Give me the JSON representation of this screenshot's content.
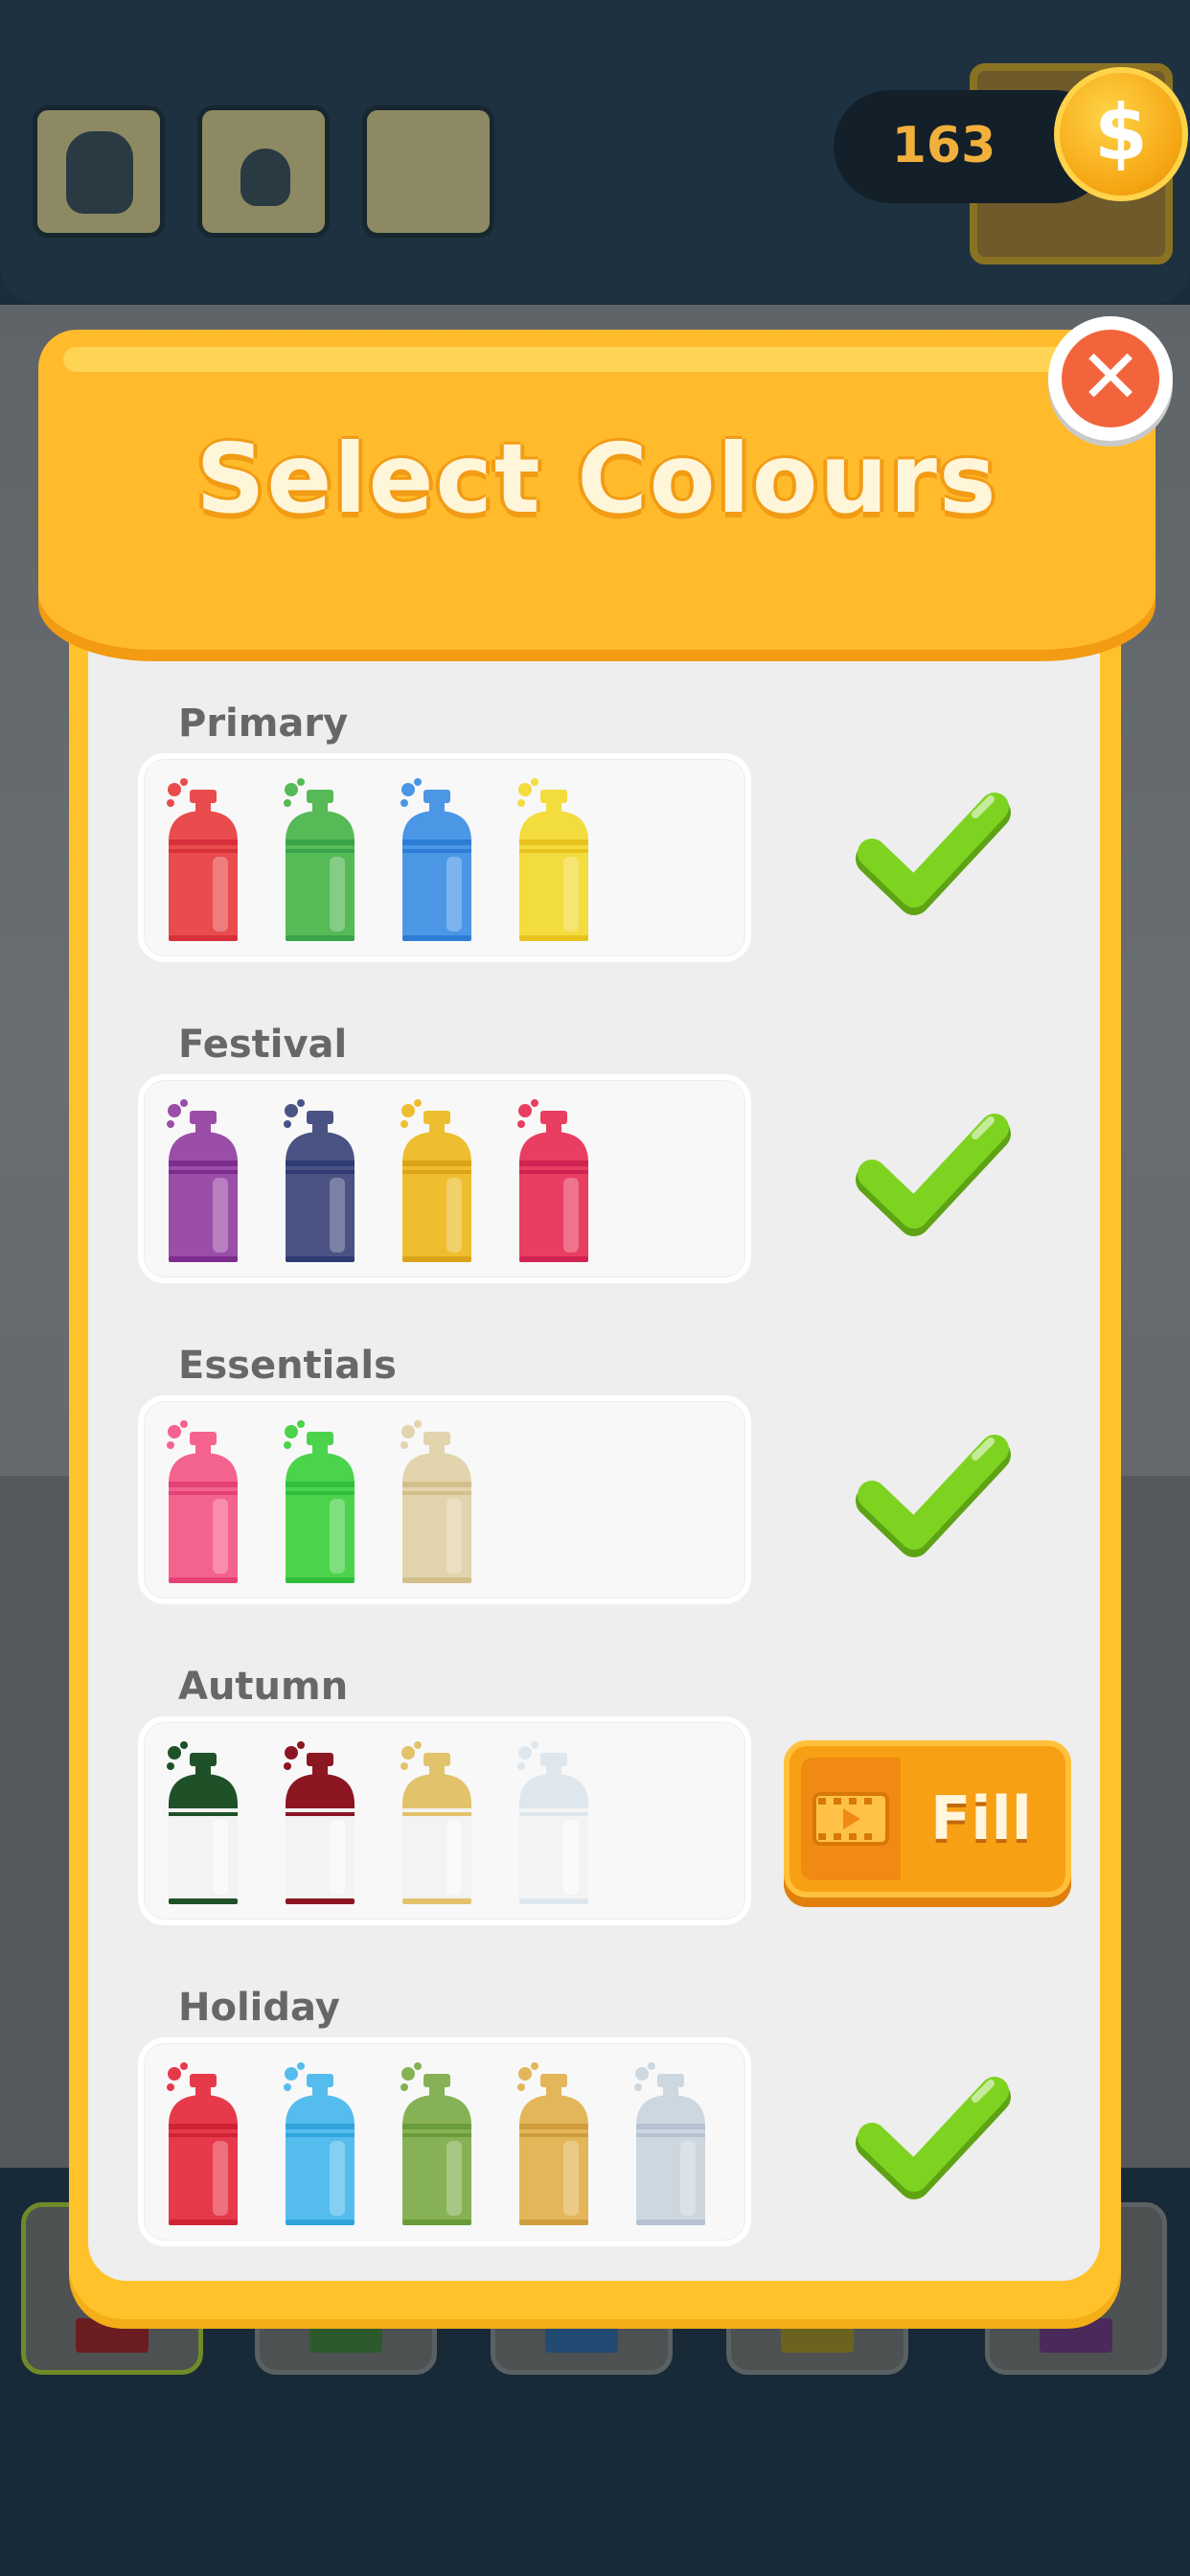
{
  "header": {
    "coins": "163",
    "coin_symbol": "$"
  },
  "modal": {
    "title": "Select Colours",
    "close_symbol": "✕",
    "fill_label": "Fill"
  },
  "palettes": [
    {
      "name": "Primary",
      "status": "selected",
      "cans": [
        {
          "color": "#e94c4c",
          "accent": "#d7303b",
          "filled": true
        },
        {
          "color": "#56ba56",
          "accent": "#39a34a",
          "filled": true
        },
        {
          "color": "#4b97e6",
          "accent": "#2d7dd6",
          "filled": true
        },
        {
          "color": "#f3dc3e",
          "accent": "#e8c31d",
          "filled": true
        }
      ]
    },
    {
      "name": "Festival",
      "status": "selected",
      "cans": [
        {
          "color": "#9b4ea8",
          "accent": "#7c2c8c",
          "filled": true
        },
        {
          "color": "#4a5383",
          "accent": "#2f3b72",
          "filled": true
        },
        {
          "color": "#eebe30",
          "accent": "#dba319",
          "filled": true
        },
        {
          "color": "#e83e62",
          "accent": "#cf2451",
          "filled": true
        }
      ]
    },
    {
      "name": "Essentials",
      "status": "selected",
      "cans": [
        {
          "color": "#f4638e",
          "accent": "#e44276",
          "filled": true
        },
        {
          "color": "#4cd34c",
          "accent": "#2fbf3c",
          "filled": true
        },
        {
          "color": "#e2d4ad",
          "accent": "#d2bf8c",
          "filled": true
        }
      ]
    },
    {
      "name": "Autumn",
      "status": "locked",
      "cans": [
        {
          "color": "#1e5128",
          "accent": "#0f3d1a",
          "filled": false
        },
        {
          "color": "#8c1622",
          "accent": "#6d0c17",
          "filled": false
        },
        {
          "color": "#e2c26b",
          "accent": "#cfa84a",
          "filled": false
        },
        {
          "color": "#dfe7ee",
          "accent": "#c9d4de",
          "filled": false
        }
      ]
    },
    {
      "name": "Holiday",
      "status": "selected",
      "cans": [
        {
          "color": "#e63a4b",
          "accent": "#cf2436",
          "filled": true
        },
        {
          "color": "#55bdee",
          "accent": "#32a4de",
          "filled": true
        },
        {
          "color": "#86b255",
          "accent": "#6a9c3a",
          "filled": true
        },
        {
          "color": "#e3b65a",
          "accent": "#cf9d3b",
          "filled": true
        },
        {
          "color": "#cdd7e0",
          "accent": "#b5c2cf",
          "filled": true
        }
      ]
    }
  ],
  "colors": {
    "check": "#7ed321",
    "panel": "#ffc22a",
    "close": "#f2653c",
    "fill_button": "#f8a014"
  }
}
